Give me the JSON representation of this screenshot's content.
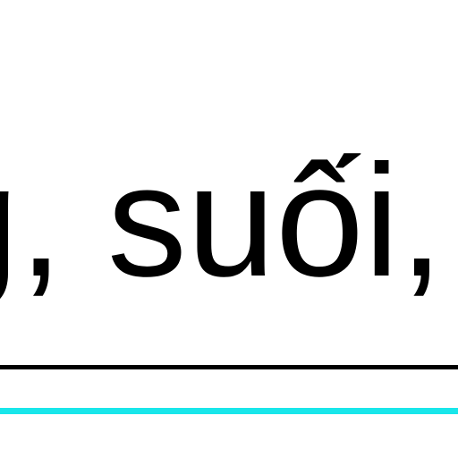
{
  "document": {
    "text_fragment": "g, suối, "
  },
  "colors": {
    "text": "#000000",
    "rule_primary": "#000000",
    "rule_accent": "#19e6ea"
  }
}
